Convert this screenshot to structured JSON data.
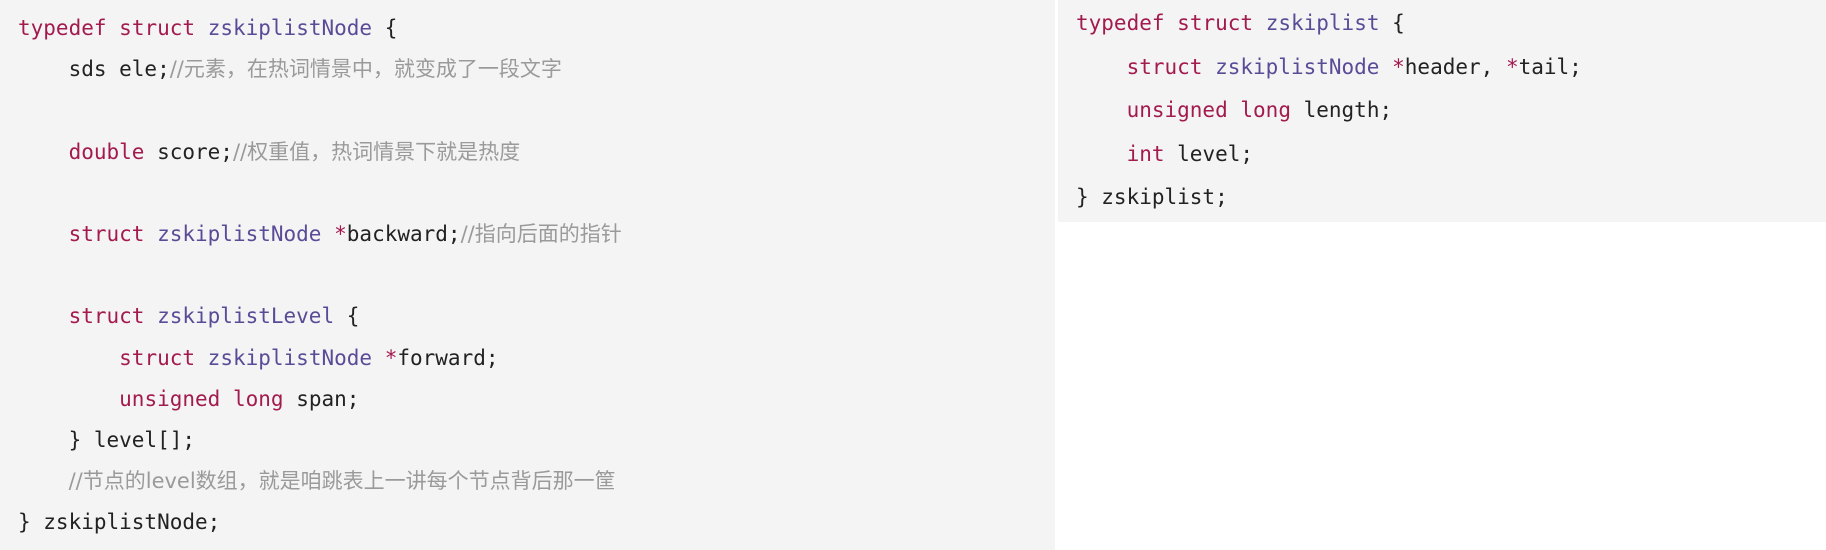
{
  "colors": {
    "keyword": "#a31a4e",
    "type": "#5a4b97",
    "comment": "#9a9a9a",
    "text": "#222222",
    "background": "#f4f4f4"
  },
  "left_code": [
    [
      [
        "kw",
        "typedef"
      ],
      [
        "t",
        " "
      ],
      [
        "kw",
        "struct"
      ],
      [
        "t",
        " "
      ],
      [
        "ty",
        "zskiplistNode"
      ],
      [
        "t",
        " {"
      ]
    ],
    [
      [
        "t",
        "    sds ele;"
      ],
      [
        "cm",
        "//元素，在热词情景中，就变成了一段文字"
      ]
    ],
    [],
    [
      [
        "t",
        "    "
      ],
      [
        "kw",
        "double"
      ],
      [
        "t",
        " score;"
      ],
      [
        "cm",
        "//权重值，热词情景下就是热度"
      ]
    ],
    [],
    [
      [
        "t",
        "    "
      ],
      [
        "kw",
        "struct"
      ],
      [
        "t",
        " "
      ],
      [
        "ty",
        "zskiplistNode"
      ],
      [
        "t",
        " "
      ],
      [
        "kw",
        "*"
      ],
      [
        "t",
        "backward;"
      ],
      [
        "cm",
        "//指向后面的指针"
      ]
    ],
    [],
    [
      [
        "t",
        "    "
      ],
      [
        "kw",
        "struct"
      ],
      [
        "t",
        " "
      ],
      [
        "ty",
        "zskiplistLevel"
      ],
      [
        "t",
        " {"
      ]
    ],
    [
      [
        "t",
        "        "
      ],
      [
        "kw",
        "struct"
      ],
      [
        "t",
        " "
      ],
      [
        "ty",
        "zskiplistNode"
      ],
      [
        "t",
        " "
      ],
      [
        "kw",
        "*"
      ],
      [
        "t",
        "forward;"
      ]
    ],
    [
      [
        "t",
        "        "
      ],
      [
        "kw",
        "unsigned"
      ],
      [
        "t",
        " "
      ],
      [
        "kw",
        "long"
      ],
      [
        "t",
        " span;"
      ]
    ],
    [
      [
        "t",
        "    } level[];"
      ]
    ],
    [
      [
        "t",
        "    "
      ],
      [
        "cm",
        "//节点的level数组，就是咱跳表上一讲每个节点背后那一筐"
      ]
    ],
    [
      [
        "t",
        "} zskiplistNode;"
      ]
    ]
  ],
  "right_code": [
    [
      [
        "kw",
        "typedef"
      ],
      [
        "t",
        " "
      ],
      [
        "kw",
        "struct"
      ],
      [
        "t",
        " "
      ],
      [
        "ty",
        "zskiplist"
      ],
      [
        "t",
        " {"
      ]
    ],
    [
      [
        "t",
        "    "
      ],
      [
        "kw",
        "struct"
      ],
      [
        "t",
        " "
      ],
      [
        "ty",
        "zskiplistNode"
      ],
      [
        "t",
        " "
      ],
      [
        "kw",
        "*"
      ],
      [
        "t",
        "header, "
      ],
      [
        "kw",
        "*"
      ],
      [
        "t",
        "tail;"
      ]
    ],
    [
      [
        "t",
        "    "
      ],
      [
        "kw",
        "unsigned"
      ],
      [
        "t",
        " "
      ],
      [
        "kw",
        "long"
      ],
      [
        "t",
        " length;"
      ]
    ],
    [
      [
        "t",
        "    "
      ],
      [
        "kw",
        "int"
      ],
      [
        "t",
        " level;"
      ]
    ],
    [
      [
        "t",
        "} zskiplist;"
      ]
    ]
  ]
}
